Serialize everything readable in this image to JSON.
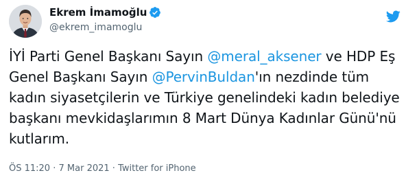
{
  "author": {
    "display_name": "Ekrem İmamoğlu",
    "handle": "@ekrem_imamoglu",
    "verified_icon": "verified-badge-icon"
  },
  "tweet": {
    "segments": [
      {
        "type": "text",
        "value": "İYİ Parti Genel Başkanı Sayın "
      },
      {
        "type": "mention",
        "value": "@meral_aksener"
      },
      {
        "type": "text",
        "value": " ve HDP Eş Genel Başkanı Sayın "
      },
      {
        "type": "mention",
        "value": "@PervinBuldan"
      },
      {
        "type": "text",
        "value": "'ın nezdinde tüm kadın siyasetçilerin ve Türkiye genelindeki kadın belediye başkanı mevkidaşlarımın 8 Mart Dünya Kadınlar Günü'nü kutlarım."
      }
    ]
  },
  "meta": {
    "time": "ÖS 11:20",
    "sep1": " · ",
    "date": "7 Mar 2021",
    "sep2": " · ",
    "source": "Twitter for iPhone"
  },
  "colors": {
    "mention": "#1b95e0",
    "twitter_blue": "#1d9bf0",
    "secondary_text": "#536471",
    "primary_text": "#0f1419"
  },
  "icons": {
    "brand": "twitter-bird-icon"
  }
}
